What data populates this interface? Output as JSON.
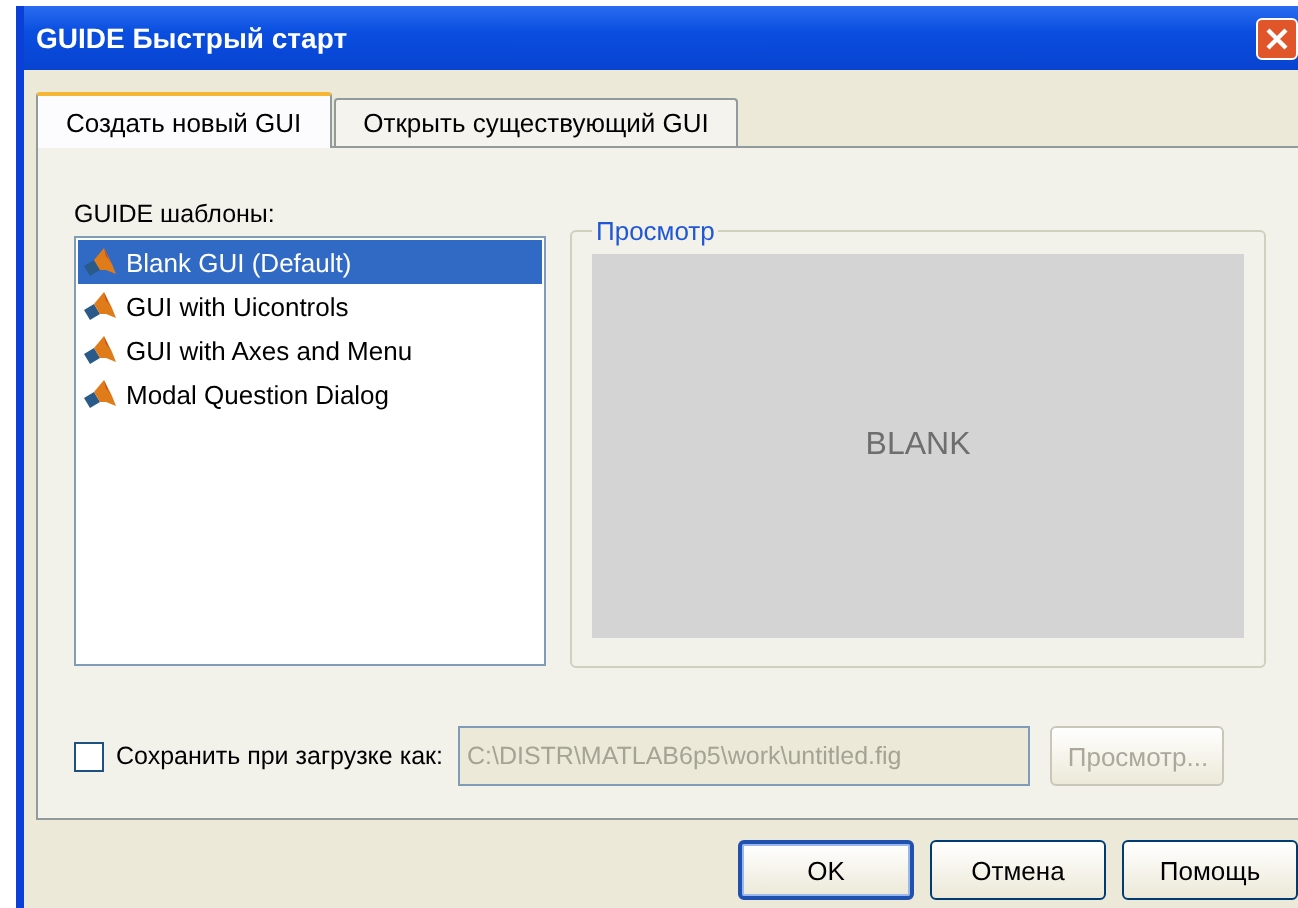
{
  "window": {
    "title": "GUIDE Быстрый старт"
  },
  "tabs": [
    {
      "label": "Создать новый GUI",
      "selected": true
    },
    {
      "label": "Открыть существующий GUI",
      "selected": false
    }
  ],
  "templates": {
    "label": "GUIDE шаблоны:",
    "items": [
      {
        "label": "Blank GUI (Default)",
        "selected": true
      },
      {
        "label": "GUI with Uicontrols",
        "selected": false
      },
      {
        "label": "GUI with Axes and Menu",
        "selected": false
      },
      {
        "label": "Modal Question Dialog",
        "selected": false
      }
    ]
  },
  "preview": {
    "legend": "Просмотр",
    "text": "BLANK"
  },
  "save_option": {
    "label": "Сохранить при загрузке как:",
    "checked": false,
    "path": "C:\\DISTR\\MATLAB6p5\\work\\untitled.fig",
    "path_disabled": true,
    "browse_label": "Просмотр...",
    "browse_disabled": true
  },
  "buttons": [
    {
      "label": "OK",
      "default": true
    },
    {
      "label": "Отмена",
      "default": false
    },
    {
      "label": "Помощь",
      "default": false
    }
  ]
}
